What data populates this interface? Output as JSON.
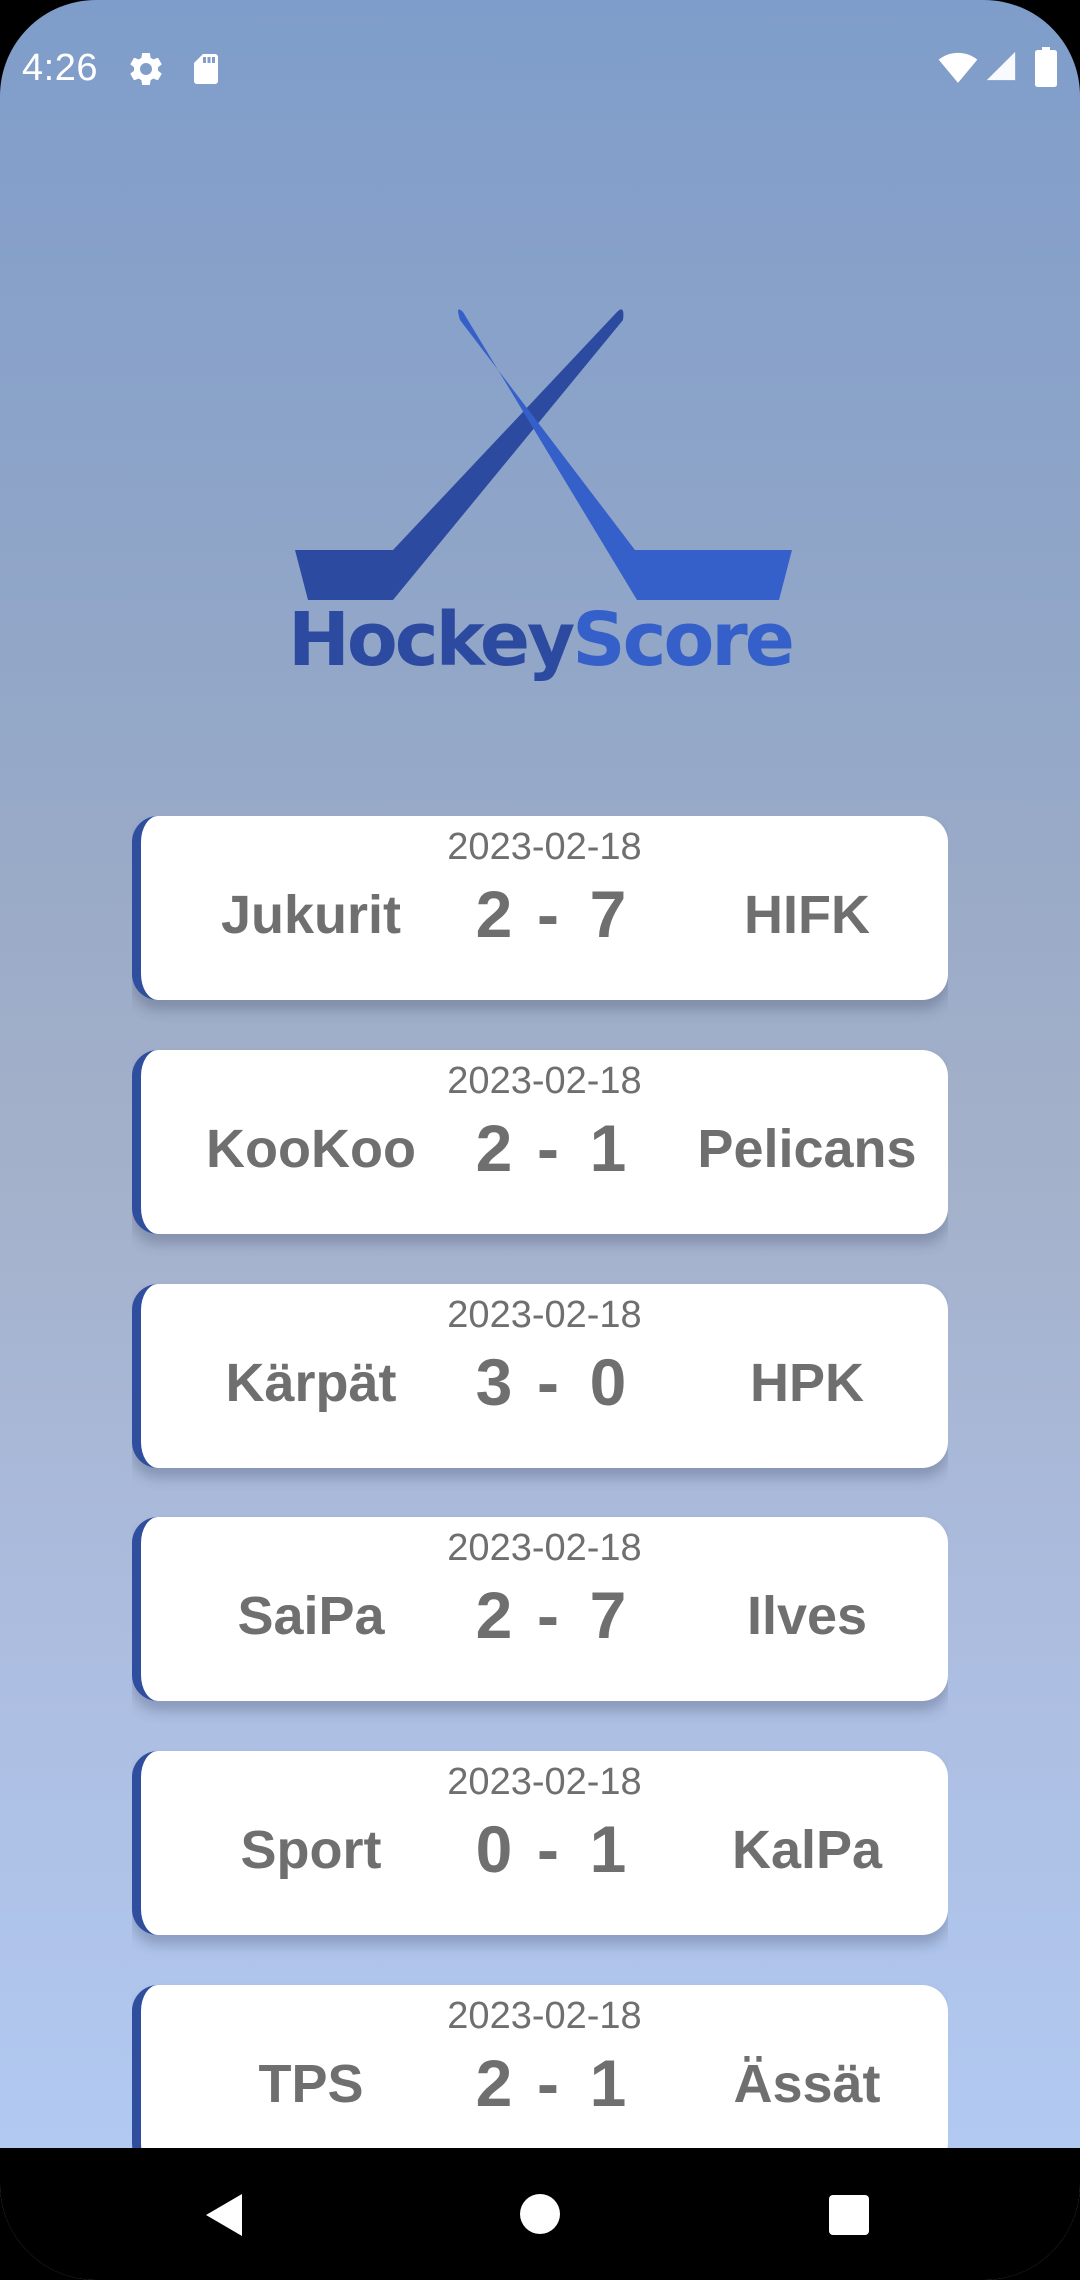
{
  "status_bar": {
    "time": "4:26",
    "left_icons": [
      "settings-icon",
      "sd-card-icon"
    ],
    "right_icons": [
      "wifi-icon",
      "cellular-signal-icon",
      "battery-icon"
    ]
  },
  "app": {
    "logo_text_part1": "Hockey",
    "logo_text_part2": "Score"
  },
  "colors": {
    "logo_dark_blue": "#2c4ba0",
    "logo_blue": "#3660c9",
    "card_accent": "#2f4e9e",
    "text_gray": "#6f6f6f"
  },
  "games": [
    {
      "date": "2023-02-18",
      "home_team": "Jukurit",
      "home_score": "2",
      "separator": "-",
      "away_score": "7",
      "away_team": "HIFK"
    },
    {
      "date": "2023-02-18",
      "home_team": "KooKoo",
      "home_score": "2",
      "separator": "-",
      "away_score": "1",
      "away_team": "Pelicans"
    },
    {
      "date": "2023-02-18",
      "home_team": "Kärpät",
      "home_score": "3",
      "separator": "-",
      "away_score": "0",
      "away_team": "HPK"
    },
    {
      "date": "2023-02-18",
      "home_team": "SaiPa",
      "home_score": "2",
      "separator": "-",
      "away_score": "7",
      "away_team": "Ilves"
    },
    {
      "date": "2023-02-18",
      "home_team": "Sport",
      "home_score": "0",
      "separator": "-",
      "away_score": "1",
      "away_team": "KalPa"
    },
    {
      "date": "2023-02-18",
      "home_team": "TPS",
      "home_score": "2",
      "separator": "-",
      "away_score": "1",
      "away_team": "Ässät"
    }
  ],
  "nav_bar": {
    "buttons": [
      "back-icon",
      "home-icon",
      "recents-icon"
    ]
  }
}
